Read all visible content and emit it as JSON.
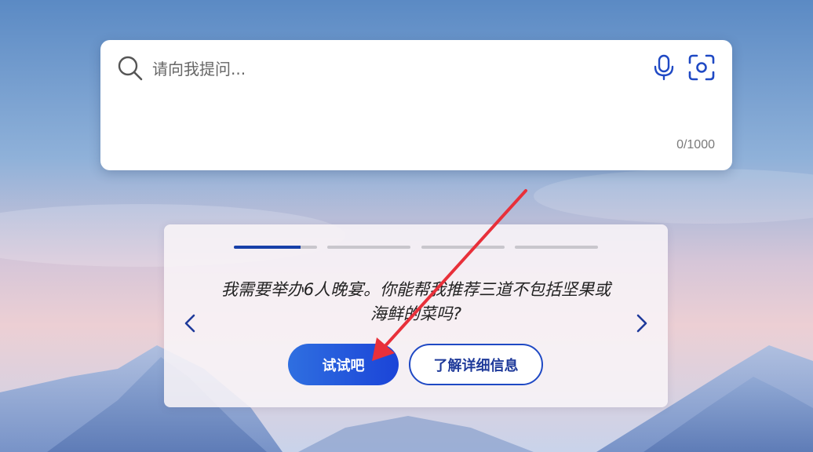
{
  "search": {
    "placeholder": "请向我提问...",
    "value": "",
    "char_count": "0/1000"
  },
  "suggestion_card": {
    "progress": [
      0.8,
      0,
      0,
      0
    ],
    "active_index": 0,
    "prompt": "我需要举办6人晚宴。你能帮我推荐三道不包括坚果或海鲜的菜吗?",
    "try_button_label": "试试吧",
    "learn_more_label": "了解详细信息"
  },
  "icons": {
    "search": "search-icon",
    "mic": "microphone-icon",
    "camera": "camera-scan-icon",
    "prev": "chevron-left-icon",
    "next": "chevron-right-icon"
  },
  "colors": {
    "accent": "#1b44d8",
    "annotation_arrow": "#e8303a"
  }
}
